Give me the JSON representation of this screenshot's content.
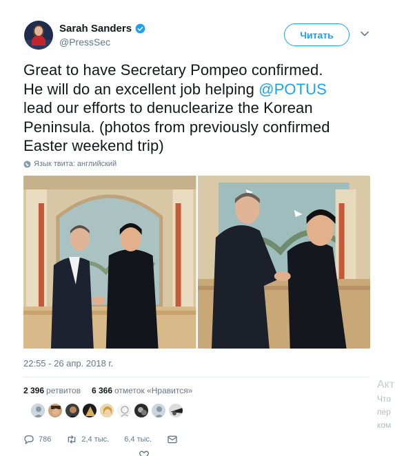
{
  "author": {
    "name": "Sarah Sanders",
    "handle": "@PressSec",
    "verified": true,
    "avatar_icon": "profile-photo"
  },
  "follow_button": {
    "label": "Читать"
  },
  "menu_icon": "chevron-down-icon",
  "tweet": {
    "text_line1": "Great to have Secretary Pompeo confirmed.",
    "text_line2_pre": "He will do an excellent job helping ",
    "mention": "@POTUS",
    "text_line3": "lead our efforts to denuclearize the Korean",
    "text_line4": "Peninsula. (photos from previously confirmed",
    "text_line5": "Easter weekend trip)",
    "language_note": "Язык твита: английский"
  },
  "photos": [
    {
      "alt": "photo-handshake-front"
    },
    {
      "alt": "photo-handshake-side"
    }
  ],
  "timestamp": "22:55 - 26 апр. 2018 г.",
  "stats": {
    "retweets_count": "2 396",
    "retweets_label": "ретвитов",
    "likes_count": "6 366",
    "likes_label": "отметок «Нравится»"
  },
  "likers_count_shown": 9,
  "actions": {
    "reply_count": "786",
    "retweet_count": "2,4 тыс.",
    "like_count": "6,4 тыс."
  },
  "sidebar": {
    "line1": "Акт",
    "line2": "Что",
    "line3": "пер",
    "line4": "ком"
  },
  "colors": {
    "accent": "#1da1f2",
    "text": "#14171a",
    "secondary": "#657786"
  }
}
